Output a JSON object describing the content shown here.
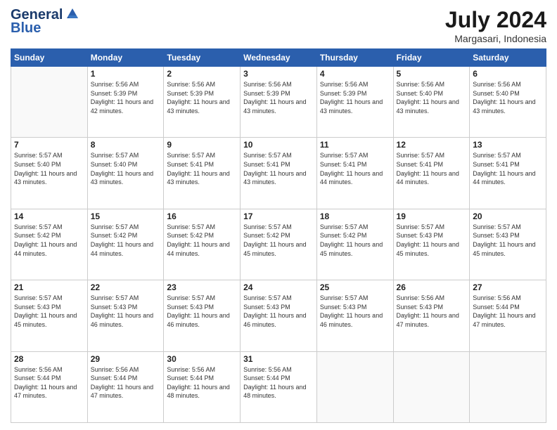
{
  "header": {
    "logo_line1": "General",
    "logo_line2": "Blue",
    "month_year": "July 2024",
    "location": "Margasari, Indonesia"
  },
  "weekdays": [
    "Sunday",
    "Monday",
    "Tuesday",
    "Wednesday",
    "Thursday",
    "Friday",
    "Saturday"
  ],
  "weeks": [
    [
      {
        "day": "",
        "empty": true
      },
      {
        "day": "1",
        "sunrise": "5:56 AM",
        "sunset": "5:39 PM",
        "daylight": "11 hours and 42 minutes."
      },
      {
        "day": "2",
        "sunrise": "5:56 AM",
        "sunset": "5:39 PM",
        "daylight": "11 hours and 43 minutes."
      },
      {
        "day": "3",
        "sunrise": "5:56 AM",
        "sunset": "5:39 PM",
        "daylight": "11 hours and 43 minutes."
      },
      {
        "day": "4",
        "sunrise": "5:56 AM",
        "sunset": "5:39 PM",
        "daylight": "11 hours and 43 minutes."
      },
      {
        "day": "5",
        "sunrise": "5:56 AM",
        "sunset": "5:40 PM",
        "daylight": "11 hours and 43 minutes."
      },
      {
        "day": "6",
        "sunrise": "5:56 AM",
        "sunset": "5:40 PM",
        "daylight": "11 hours and 43 minutes."
      }
    ],
    [
      {
        "day": "7",
        "sunrise": "5:57 AM",
        "sunset": "5:40 PM",
        "daylight": "11 hours and 43 minutes."
      },
      {
        "day": "8",
        "sunrise": "5:57 AM",
        "sunset": "5:40 PM",
        "daylight": "11 hours and 43 minutes."
      },
      {
        "day": "9",
        "sunrise": "5:57 AM",
        "sunset": "5:41 PM",
        "daylight": "11 hours and 43 minutes."
      },
      {
        "day": "10",
        "sunrise": "5:57 AM",
        "sunset": "5:41 PM",
        "daylight": "11 hours and 43 minutes."
      },
      {
        "day": "11",
        "sunrise": "5:57 AM",
        "sunset": "5:41 PM",
        "daylight": "11 hours and 44 minutes."
      },
      {
        "day": "12",
        "sunrise": "5:57 AM",
        "sunset": "5:41 PM",
        "daylight": "11 hours and 44 minutes."
      },
      {
        "day": "13",
        "sunrise": "5:57 AM",
        "sunset": "5:41 PM",
        "daylight": "11 hours and 44 minutes."
      }
    ],
    [
      {
        "day": "14",
        "sunrise": "5:57 AM",
        "sunset": "5:42 PM",
        "daylight": "11 hours and 44 minutes."
      },
      {
        "day": "15",
        "sunrise": "5:57 AM",
        "sunset": "5:42 PM",
        "daylight": "11 hours and 44 minutes."
      },
      {
        "day": "16",
        "sunrise": "5:57 AM",
        "sunset": "5:42 PM",
        "daylight": "11 hours and 44 minutes."
      },
      {
        "day": "17",
        "sunrise": "5:57 AM",
        "sunset": "5:42 PM",
        "daylight": "11 hours and 45 minutes."
      },
      {
        "day": "18",
        "sunrise": "5:57 AM",
        "sunset": "5:42 PM",
        "daylight": "11 hours and 45 minutes."
      },
      {
        "day": "19",
        "sunrise": "5:57 AM",
        "sunset": "5:43 PM",
        "daylight": "11 hours and 45 minutes."
      },
      {
        "day": "20",
        "sunrise": "5:57 AM",
        "sunset": "5:43 PM",
        "daylight": "11 hours and 45 minutes."
      }
    ],
    [
      {
        "day": "21",
        "sunrise": "5:57 AM",
        "sunset": "5:43 PM",
        "daylight": "11 hours and 45 minutes."
      },
      {
        "day": "22",
        "sunrise": "5:57 AM",
        "sunset": "5:43 PM",
        "daylight": "11 hours and 46 minutes."
      },
      {
        "day": "23",
        "sunrise": "5:57 AM",
        "sunset": "5:43 PM",
        "daylight": "11 hours and 46 minutes."
      },
      {
        "day": "24",
        "sunrise": "5:57 AM",
        "sunset": "5:43 PM",
        "daylight": "11 hours and 46 minutes."
      },
      {
        "day": "25",
        "sunrise": "5:57 AM",
        "sunset": "5:43 PM",
        "daylight": "11 hours and 46 minutes."
      },
      {
        "day": "26",
        "sunrise": "5:56 AM",
        "sunset": "5:43 PM",
        "daylight": "11 hours and 47 minutes."
      },
      {
        "day": "27",
        "sunrise": "5:56 AM",
        "sunset": "5:44 PM",
        "daylight": "11 hours and 47 minutes."
      }
    ],
    [
      {
        "day": "28",
        "sunrise": "5:56 AM",
        "sunset": "5:44 PM",
        "daylight": "11 hours and 47 minutes."
      },
      {
        "day": "29",
        "sunrise": "5:56 AM",
        "sunset": "5:44 PM",
        "daylight": "11 hours and 47 minutes."
      },
      {
        "day": "30",
        "sunrise": "5:56 AM",
        "sunset": "5:44 PM",
        "daylight": "11 hours and 48 minutes."
      },
      {
        "day": "31",
        "sunrise": "5:56 AM",
        "sunset": "5:44 PM",
        "daylight": "11 hours and 48 minutes."
      },
      {
        "day": "",
        "empty": true
      },
      {
        "day": "",
        "empty": true
      },
      {
        "day": "",
        "empty": true
      }
    ]
  ]
}
